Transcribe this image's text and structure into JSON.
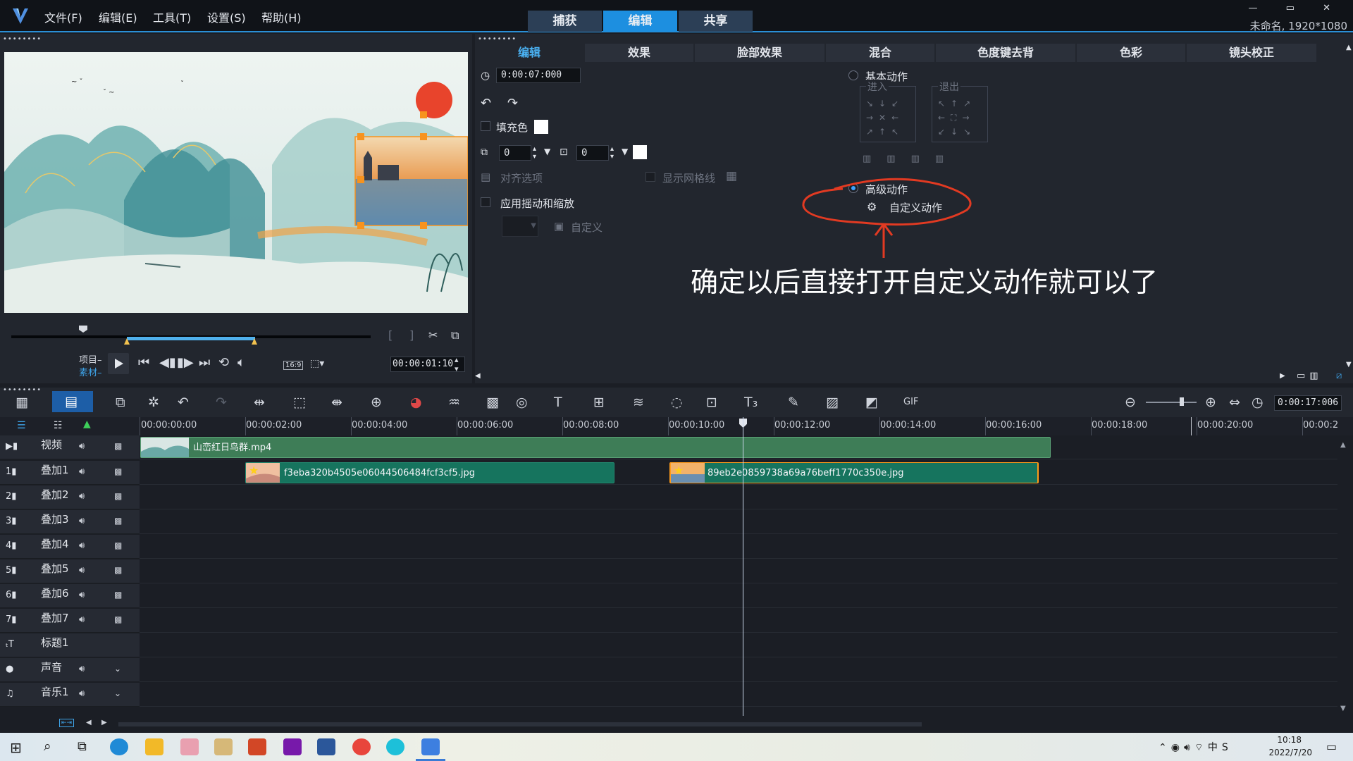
{
  "app": {
    "menu": [
      "文件(F)",
      "编辑(E)",
      "工具(T)",
      "设置(S)",
      "帮助(H)"
    ],
    "mode_tabs": [
      "捕获",
      "编辑",
      "共享"
    ],
    "window_controls": "— ▭ ✕",
    "project_name": "未命名, 1920*1080"
  },
  "preview": {
    "grip": "••••••••",
    "project_label": "项目–",
    "clip_label": "素材–",
    "timecode": "00:00:01:10",
    "aspect": "16:9",
    "mark_in": "[",
    "mark_out": "]"
  },
  "options": {
    "grip": "••••••••",
    "tabs": [
      "编辑",
      "效果",
      "脸部效果",
      "混合",
      "色度键去背",
      "色彩",
      "镜头校正"
    ],
    "duration": "0:00:07:000",
    "fill_color_label": "填充色",
    "border_value": "0",
    "shadow_value": "0",
    "align_options": "对齐选项",
    "show_grid": "显示网格线",
    "apply_pan_zoom": "应用摇动和缩放",
    "custom": "自定义",
    "basic_motion": "基本动作",
    "enter": "进入",
    "exit": "退出",
    "advanced_motion": "高级动作",
    "custom_motion": "自定义动作",
    "annotation": "确定以后直接打开自定义动作就可以了",
    "annotation_color": "#e23a22"
  },
  "timeline": {
    "timecode": "0:00:17:006",
    "ruler": [
      "00:00:00:00",
      "00:00:02:00",
      "00:00:04:00",
      "00:00:06:00",
      "00:00:08:00",
      "00:00:10:00",
      "00:00:12:00",
      "00:00:14:00",
      "00:00:16:00",
      "00:00:18:00",
      "00:00:20:00",
      "00:00:2"
    ],
    "tracks": [
      {
        "icon": "▶▮",
        "label": "视频"
      },
      {
        "icon": "1▮",
        "label": "叠加1"
      },
      {
        "icon": "2▮",
        "label": "叠加2"
      },
      {
        "icon": "3▮",
        "label": "叠加3"
      },
      {
        "icon": "4▮",
        "label": "叠加4"
      },
      {
        "icon": "5▮",
        "label": "叠加5"
      },
      {
        "icon": "6▮",
        "label": "叠加6"
      },
      {
        "icon": "7▮",
        "label": "叠加7"
      },
      {
        "icon": "ₜT",
        "label": "标题1"
      },
      {
        "icon": "●",
        "label": "声音"
      },
      {
        "icon": "♫",
        "label": "音乐1"
      }
    ],
    "clips": {
      "video": "山峦红日鸟群.mp4",
      "overlay1_a": "f3eba320b4505e06044506484fcf3cf5.jpg",
      "overlay1_b": "89eb2e0859738a69a76beff1770c350e.jpg"
    }
  },
  "taskbar": {
    "time": "10:18",
    "date": "2022/7/20"
  }
}
